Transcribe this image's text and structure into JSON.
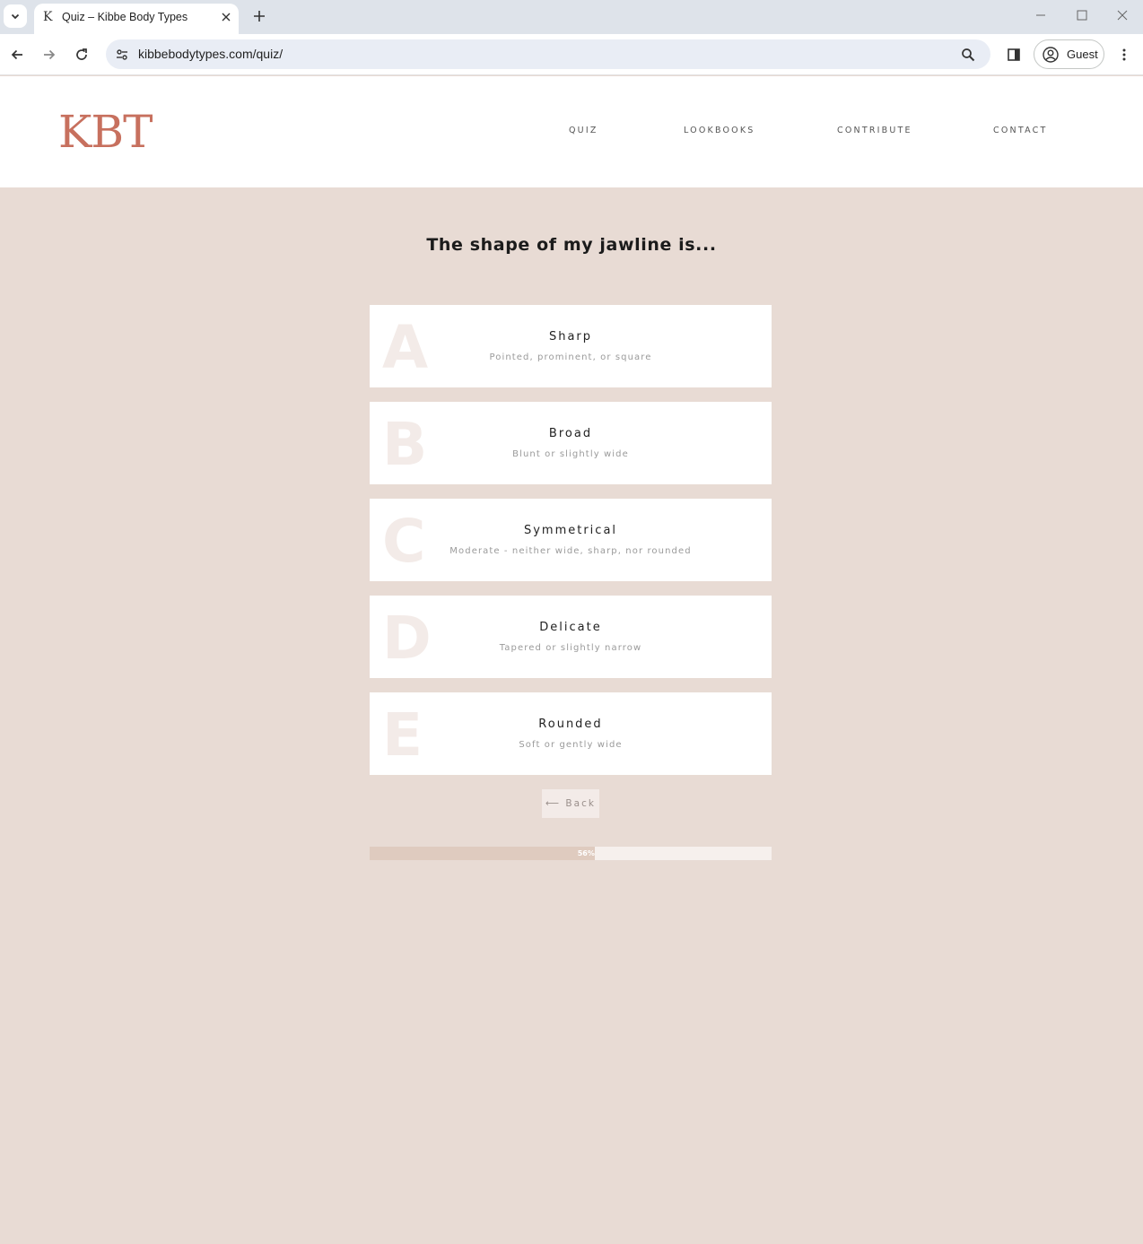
{
  "browser": {
    "tab_favicon": "K",
    "tab_title": "Quiz – Kibbe Body Types",
    "url": "kibbebodytypes.com/quiz/",
    "profile_label": "Guest"
  },
  "site": {
    "logo": "KBT",
    "nav": [
      "QUIZ",
      "LOOKBOOKS",
      "CONTRIBUTE",
      "CONTACT"
    ],
    "brand_color": "#c7705e",
    "background_color": "#e8dbd4"
  },
  "quiz": {
    "question": "The shape of my jawline is...",
    "options": [
      {
        "letter": "A",
        "title": "Sharp",
        "subtitle": "Pointed, prominent, or square"
      },
      {
        "letter": "B",
        "title": "Broad",
        "subtitle": "Blunt or slightly wide"
      },
      {
        "letter": "C",
        "title": "Symmetrical",
        "subtitle": "Moderate - neither wide, sharp, nor rounded"
      },
      {
        "letter": "D",
        "title": "Delicate",
        "subtitle": "Tapered or slightly narrow"
      },
      {
        "letter": "E",
        "title": "Rounded",
        "subtitle": "Soft or gently wide"
      }
    ],
    "back_label": "⟵ Back",
    "progress": {
      "percent": 56,
      "label": "56%"
    }
  }
}
